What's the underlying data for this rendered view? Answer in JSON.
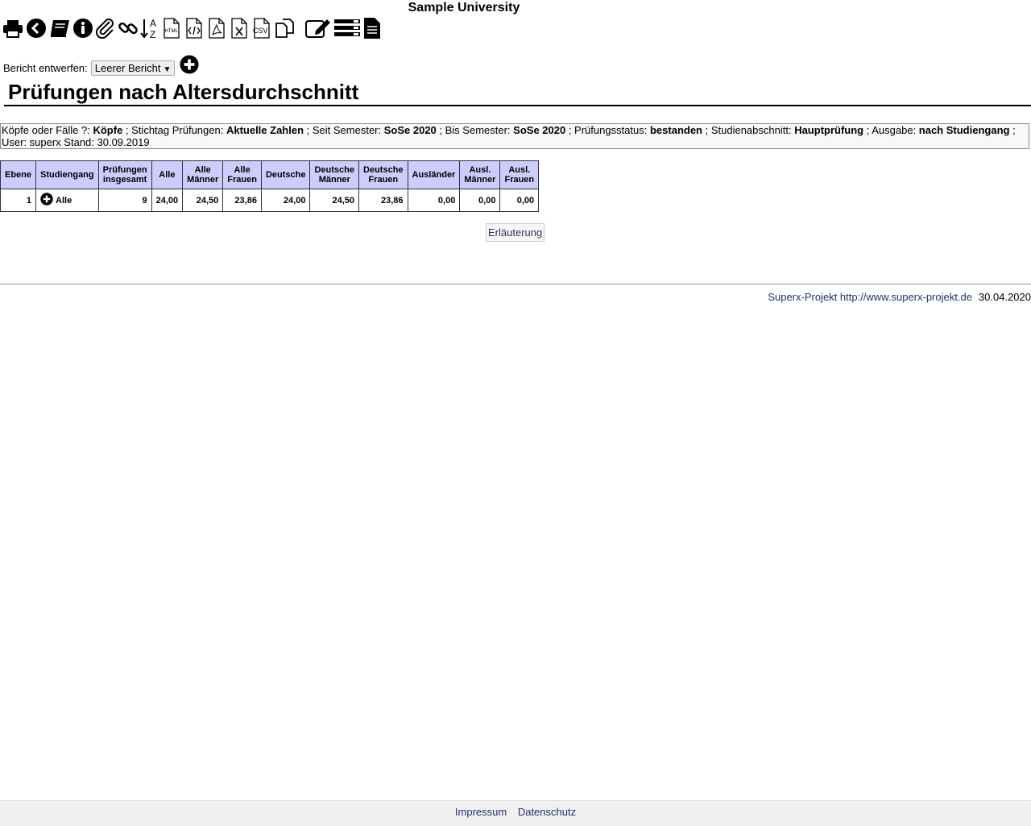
{
  "university": "Sample University",
  "toolbar": [
    {
      "icon": "print-icon"
    },
    {
      "icon": "back-icon"
    },
    {
      "icon": "book-icon"
    },
    {
      "icon": "info-icon"
    },
    {
      "icon": "paperclip-icon"
    },
    {
      "icon": "link-icon"
    },
    {
      "icon": "sort-az-icon",
      "text": "A Z"
    },
    {
      "icon": "html-export-icon",
      "text": "HTML"
    },
    {
      "icon": "code-export-icon"
    },
    {
      "icon": "pdf-export-icon"
    },
    {
      "icon": "excel-export-icon"
    },
    {
      "icon": "csv-export-icon",
      "text": "CSV"
    },
    {
      "icon": "copy-icon"
    },
    {
      "icon": "edit-icon"
    },
    {
      "icon": "list-icon"
    },
    {
      "icon": "document-icon"
    }
  ],
  "designer": {
    "label": "Bericht entwerfen:",
    "selected": "Leerer Bericht",
    "arrow": "▼"
  },
  "title": "Prüfungen nach Altersdurchschnitt",
  "params": {
    "p1_label": "Köpfe oder Fälle ?: ",
    "p1_value": "Köpfe",
    "p2_label": " ; Stichtag Prüfungen: ",
    "p2_value": "Aktuelle Zahlen",
    "p3_label": " ; Seit Semester: ",
    "p3_value": "SoSe 2020",
    "p4_label": " ; Bis Semester: ",
    "p4_value": "SoSe 2020",
    "p5_label": " ; Prüfungsstatus: ",
    "p5_value": "bestanden",
    "p6_label": " ; Studienabschnitt: ",
    "p6_value": "Hauptprüfung",
    "p7_label": " ; Ausgabe: ",
    "p7_value": "nach Studiengang",
    "tail": " ; User: superx  Stand: 30.09.2019"
  },
  "table": {
    "headers": [
      "Ebene",
      "Studiengang",
      "Prüfungen insgesamt",
      "Alle",
      "Alle Männer",
      "Alle Frauen",
      "Deutsche",
      "Deutsche Männer",
      "Deutsche Frauen",
      "Ausländer",
      "Ausl. Männer",
      "Ausl. Frauen"
    ],
    "row": {
      "ebene": "1",
      "studiengang": "Alle",
      "pruefungen": "9",
      "alle": "24,00",
      "alle_m": "24,50",
      "alle_f": "23,86",
      "de": "24,00",
      "de_m": "24,50",
      "de_f": "23,86",
      "aus": "0,00",
      "aus_m": "0,00",
      "aus_f": "0,00"
    }
  },
  "explain_label": "Erläuterung",
  "superx": {
    "link": "Superx-Projekt http://www.superx-projekt.de",
    "date": "30.04.2020"
  },
  "footer": {
    "impressum": "Impressum",
    "datenschutz": "Datenschutz"
  }
}
